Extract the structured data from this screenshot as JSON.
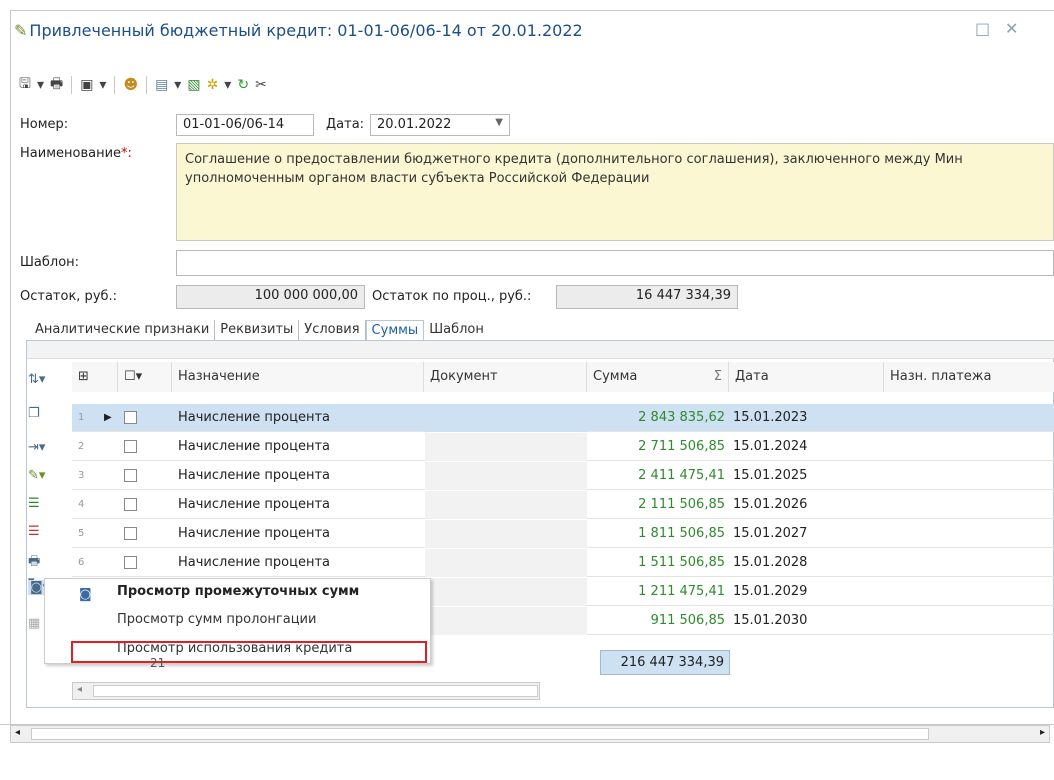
{
  "window": {
    "title": "Привлеченный бюджетный кредит: 01-01-06/06-14 от 20.01.2022"
  },
  "form": {
    "number_label": "Номер:",
    "number_value": "01-01-06/06-14",
    "date_label": "Дата:",
    "date_value": "20.01.2022",
    "name_label": "Наименование",
    "name_required": "*:",
    "name_value": "Соглашение о предоставлении бюджетного кредита (дополнительного соглашения), заключенного между Мин уполномоченным органом власти субъекта Российской Федерации",
    "template_label": "Шаблон:",
    "template_value": "",
    "balance_label": "Остаток, руб.:",
    "balance_value": "100 000 000,00",
    "interest_balance_label": "Остаток по проц., руб.:",
    "interest_balance_value": "16 447 334,39"
  },
  "tabs": [
    {
      "label": "Аналитические признаки"
    },
    {
      "label": "Реквизиты"
    },
    {
      "label": "Условия"
    },
    {
      "label": "Суммы",
      "active": true
    },
    {
      "label": "Шаблон"
    }
  ],
  "grid": {
    "columns": [
      "Назначение",
      "Документ",
      "Сумма",
      "Дата",
      "Назн. платежа"
    ],
    "sum_icon": "Σ",
    "rows": [
      {
        "n": "1",
        "purpose": "Начисление процента",
        "doc": "",
        "sum": "2 843 835,62",
        "date": "15.01.2023"
      },
      {
        "n": "2",
        "purpose": "Начисление процента",
        "doc": "",
        "sum": "2 711 506,85",
        "date": "15.01.2024"
      },
      {
        "n": "3",
        "purpose": "Начисление процента",
        "doc": "",
        "sum": "2 411 475,41",
        "date": "15.01.2025"
      },
      {
        "n": "4",
        "purpose": "Начисление процента",
        "doc": "",
        "sum": "2 111 506,85",
        "date": "15.01.2026"
      },
      {
        "n": "5",
        "purpose": "Начисление процента",
        "doc": "",
        "sum": "1 811 506,85",
        "date": "15.01.2027"
      },
      {
        "n": "6",
        "purpose": "Начисление процента",
        "doc": "",
        "sum": "1 511 506,85",
        "date": "15.01.2028"
      },
      {
        "n": "",
        "purpose": "",
        "doc": "",
        "sum": "1 211 475,41",
        "date": "15.01.2029"
      },
      {
        "n": "",
        "purpose": "",
        "doc": "",
        "sum": "911 506,85",
        "date": "15.01.2030"
      }
    ],
    "footer_count": "21",
    "footer_total": "216 447 334,39"
  },
  "context_menu": {
    "items": [
      {
        "label": "Просмотр промежуточных сумм"
      },
      {
        "label": "Просмотр сумм пролонгации"
      },
      {
        "label": "Просмотр использования кредита"
      }
    ]
  }
}
